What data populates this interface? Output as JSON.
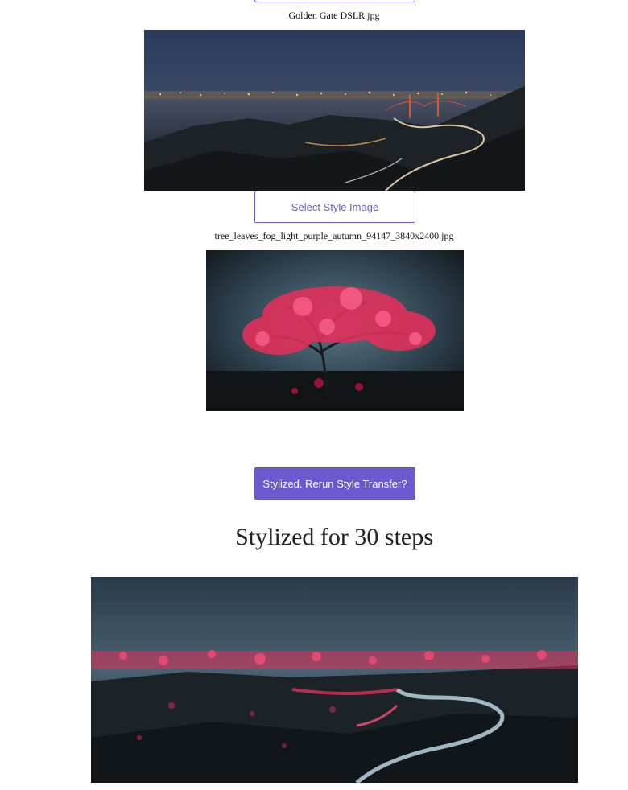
{
  "content_image": {
    "filename": "Golden Gate DSLR.jpg"
  },
  "style_image": {
    "button_label": "Select Style Image",
    "filename": "tree_leaves_fog_light_purple_autumn_94147_3840x2400.jpg"
  },
  "transfer": {
    "button_label": "Stylized. Rerun Style Transfer?"
  },
  "result": {
    "heading": "Stylized for 30 steps"
  },
  "colors": {
    "accent": "#6a5acd",
    "night_sky": "#2a3550",
    "red_leaves": "#e0305a"
  }
}
